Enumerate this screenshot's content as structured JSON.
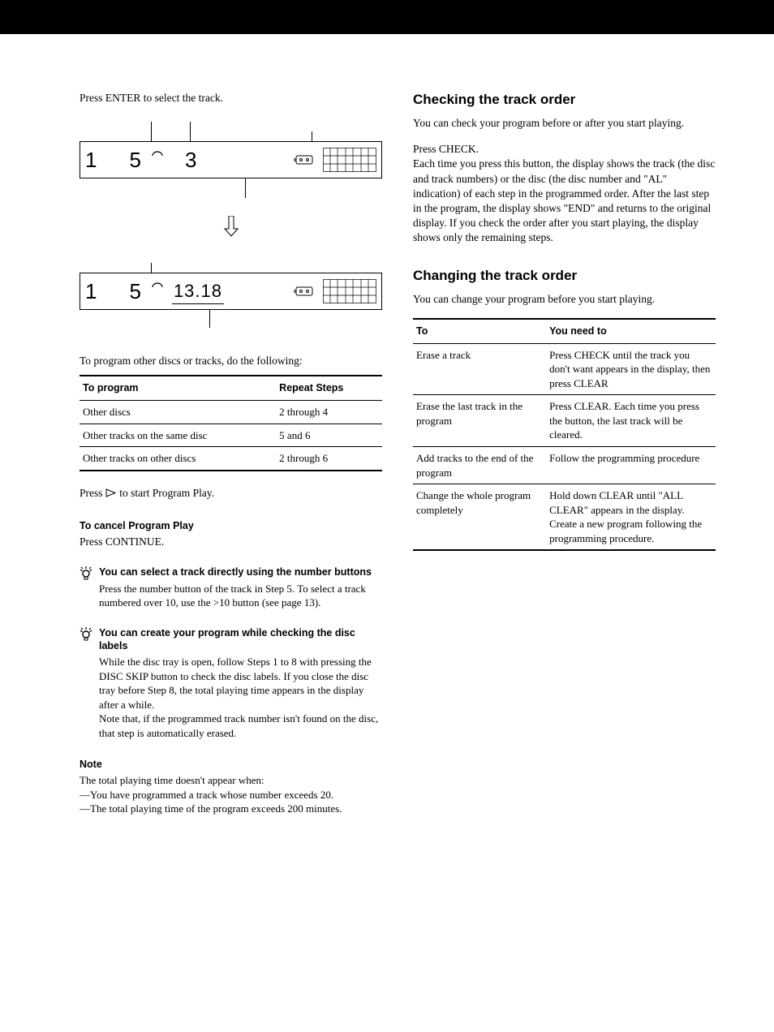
{
  "left": {
    "intro": "Press ENTER to select the track.",
    "display1": {
      "disc": "1",
      "track": "5",
      "extra": "3"
    },
    "display2": {
      "disc": "1",
      "track": "5",
      "time": "13.18"
    },
    "program_intro": "To program other discs or tracks, do the following:",
    "table_headers": {
      "col1": "To program",
      "col2": "Repeat Steps"
    },
    "table_rows": [
      {
        "c1": "Other discs",
        "c2": "2 through 4"
      },
      {
        "c1": "Other tracks on the same disc",
        "c2": "5 and 6"
      },
      {
        "c1": "Other tracks on other discs",
        "c2": "2 through 6"
      }
    ],
    "play_line_pre": "Press ",
    "play_line_post": " to start Program Play.",
    "cancel_title": "To cancel Program Play",
    "cancel_body": "Press CONTINUE.",
    "tip1_title": "You can select a track directly using the number buttons",
    "tip1_body": "Press the number button of the track in Step 5. To select a track numbered over 10, use the >10 button (see page 13).",
    "tip2_title": "You can create your program while checking the disc labels",
    "tip2_body": "While the disc tray is open, follow Steps 1 to 8 with pressing the DISC SKIP button to check the disc labels. If you close the disc tray before Step 8, the total playing time appears in the display after a while.\nNote that, if the programmed track number isn't found on the disc, that step is automatically erased.",
    "note_title": "Note",
    "note_intro": "The total playing time doesn't appear when:",
    "note_lines": [
      "—You have programmed a track whose number exceeds 20.",
      "—The total playing time of the program exceeds 200 minutes."
    ]
  },
  "right": {
    "sec1_title": "Checking the track order",
    "sec1_intro": "You can check your program before or after you start playing.",
    "sec1_sub": "Press CHECK.",
    "sec1_body": "Each time you press this button, the display shows the track (the disc and track numbers) or the disc (the disc number and \"AL\" indication) of each step in the programmed order. After the last step in the program, the display shows \"END\" and returns to the original display. If you check the order after you start playing, the display shows only the remaining steps.",
    "sec2_title": "Changing the track order",
    "sec2_intro": "You can change your program before you start playing.",
    "table_headers": {
      "col1": "To",
      "col2": "You need to"
    },
    "table_rows": [
      {
        "c1": "Erase a track",
        "c2": "Press CHECK until the track you don't want appears in the display, then press CLEAR"
      },
      {
        "c1": "Erase the last track in the program",
        "c2": "Press CLEAR. Each time you press the button, the last track will be cleared."
      },
      {
        "c1": "Add tracks to the end of the program",
        "c2": "Follow the programming procedure"
      },
      {
        "c1": "Change the whole program completely",
        "c2": "Hold down CLEAR until \"ALL CLEAR\" appears in the display. Create a new program following the programming procedure."
      }
    ]
  }
}
